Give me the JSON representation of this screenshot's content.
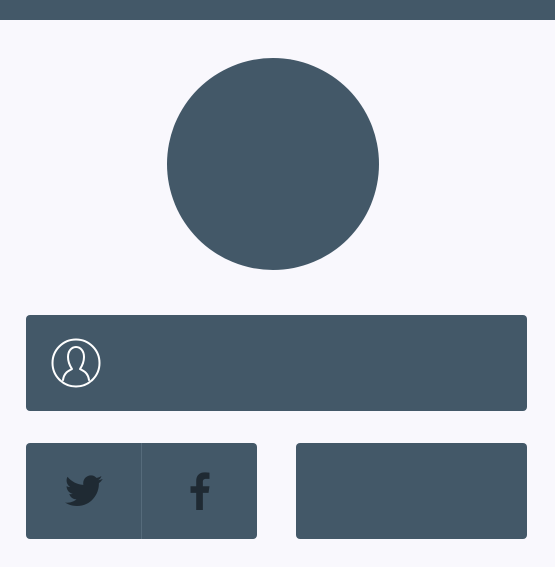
{
  "colors": {
    "background": "#f9f8fd",
    "panel": "#435868",
    "icon_outline": "#ffffff",
    "social_icon": "#1f2a33"
  },
  "header": {
    "bar": "top-bar"
  },
  "avatar": {
    "icon": "avatar-circle"
  },
  "profile": {
    "icon": "user-outline-icon"
  },
  "social": {
    "twitter_icon": "twitter-icon",
    "facebook_icon": "facebook-icon"
  },
  "right_panel": {
    "name": "blank-panel"
  }
}
